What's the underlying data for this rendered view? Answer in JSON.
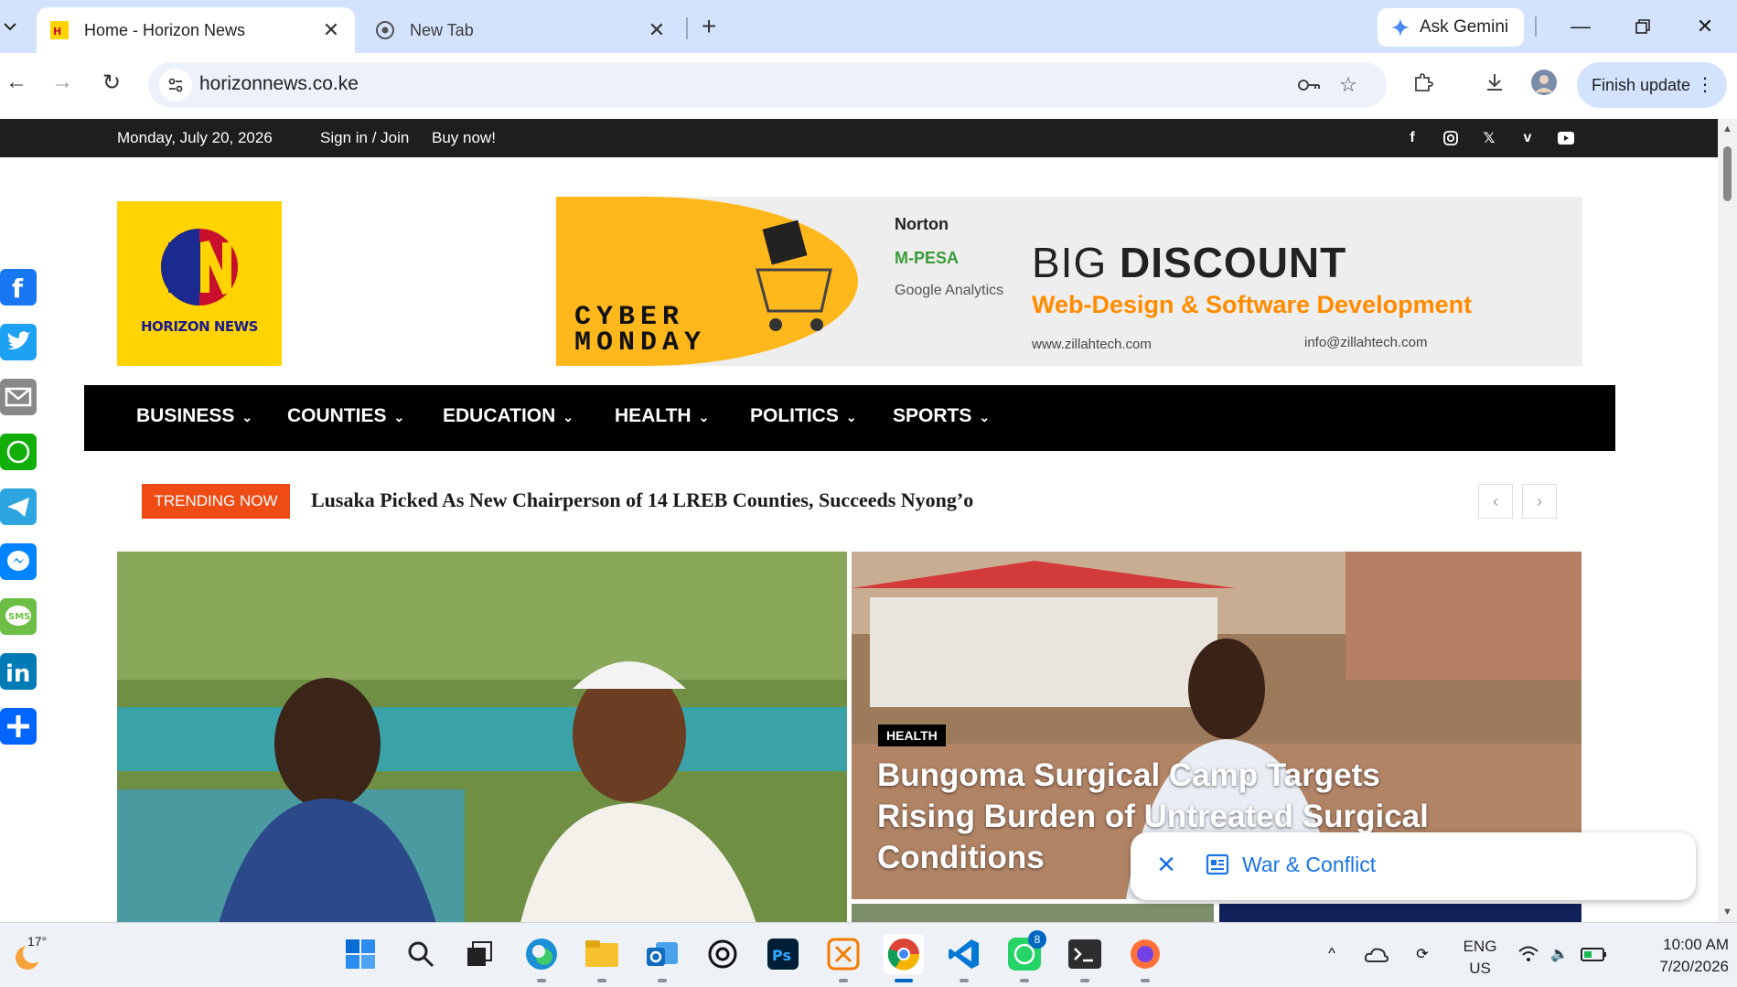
{
  "browser": {
    "tabs": [
      {
        "title": "Home - Horizon News",
        "active": true
      },
      {
        "title": "New Tab",
        "active": false
      }
    ],
    "ask_gemini": "Ask Gemini",
    "url": "horizonnews.co.ke",
    "finish_update": "Finish update"
  },
  "site": {
    "date": "Monday, July 20, 2026",
    "signin": "Sign in / Join",
    "buy": "Buy now!",
    "logo_text": "HORIZON NEWS",
    "social_icons": [
      "facebook-icon",
      "instagram-icon",
      "x-icon",
      "vimeo-icon",
      "youtube-icon"
    ],
    "banner": {
      "cyber_monday": "CYBER MONDAY",
      "brands": [
        "Norton",
        "M-PESA",
        "Google Analytics"
      ],
      "headline_light": "BIG ",
      "headline_bold": "DISCOUNT",
      "tagline": "Web-Design & Software Development",
      "website": "www.zillahtech.com",
      "email": "info@zillahtech.com"
    },
    "nav": [
      "BUSINESS",
      "COUNTIES",
      "EDUCATION",
      "HEALTH",
      "POLITICS",
      "SPORTS"
    ],
    "trending_label": "TRENDING NOW",
    "trending_headline": "Lusaka Picked As New Chairperson of 14 LREB Counties, Succeeds Nyong’o",
    "feature_right": {
      "category": "HEALTH",
      "title": "Bungoma Surgical Camp Targets Rising Burden of Untreated Surgical Conditions"
    },
    "toast": {
      "label": "War & Conflict"
    },
    "share_buttons": [
      "facebook",
      "twitter",
      "email",
      "whatsapp",
      "telegram",
      "messenger",
      "sms",
      "linkedin",
      "share"
    ]
  },
  "taskbar": {
    "temperature": "17°",
    "apps": [
      "windows-start",
      "search",
      "task-view",
      "edge",
      "file-explorer",
      "outlook",
      "chatgpt",
      "photoshop",
      "xampp",
      "chrome",
      "vscode",
      "whatsapp",
      "terminal",
      "firefox"
    ],
    "whatsapp_badge": "8",
    "language": "ENG",
    "region": "US",
    "time": "10:00 AM",
    "date": "7/20/2026"
  },
  "colors": {
    "tabstrip": "#d3e3fd",
    "accent_orange": "#ef4b14",
    "logo_yellow": "#ffd400",
    "nav_black": "#000000"
  }
}
